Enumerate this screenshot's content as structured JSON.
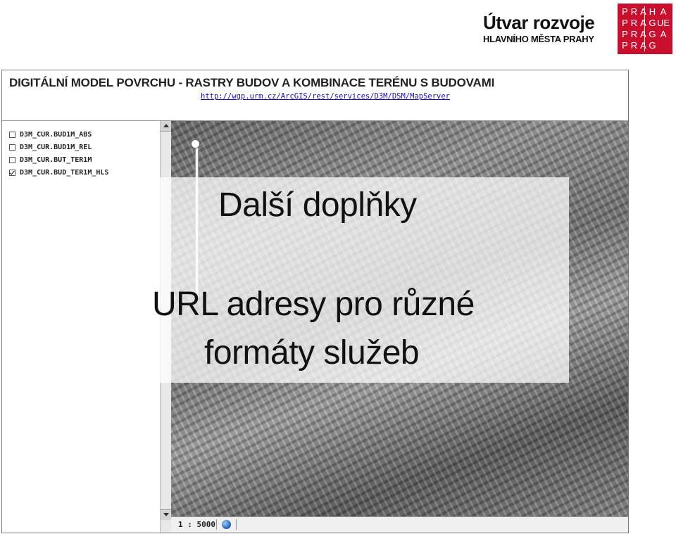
{
  "brand": {
    "title": "Útvar rozvoje",
    "subtitle": "HLAVNÍHO MĚSTA PRAHY",
    "logo_cells": [
      "P",
      "R",
      "A",
      "H",
      "A",
      "P",
      "R",
      "A",
      "G",
      "UE",
      "P",
      "R",
      "A",
      "G",
      "A",
      "P",
      "R",
      "A",
      "G",
      ""
    ],
    "logo_color": "#c8102e"
  },
  "viewer": {
    "title": "DIGITÁLNÍ MODEL POVRCHU - RASTRY BUDOV A KOMBINACE TERÉNU S BUDOVAMI",
    "url": "http://wgp.urm.cz/ArcGIS/rest/services/D3M/DSM/MapServer",
    "layers": [
      {
        "label": "D3M_CUR.BUD1M_ABS",
        "checked": false
      },
      {
        "label": "D3M_CUR.BUD1M_REL",
        "checked": false
      },
      {
        "label": "D3M_CUR.BUT_TER1M",
        "checked": false
      },
      {
        "label": "D3M_CUR.BUD_TER1M_HLS",
        "checked": true
      }
    ],
    "scale": "1 : 5000",
    "status_icon": "globe-icon"
  },
  "overlay": {
    "heading": "Další doplňky",
    "line1": "URL adresy pro různé",
    "line2": "formáty služeb"
  }
}
